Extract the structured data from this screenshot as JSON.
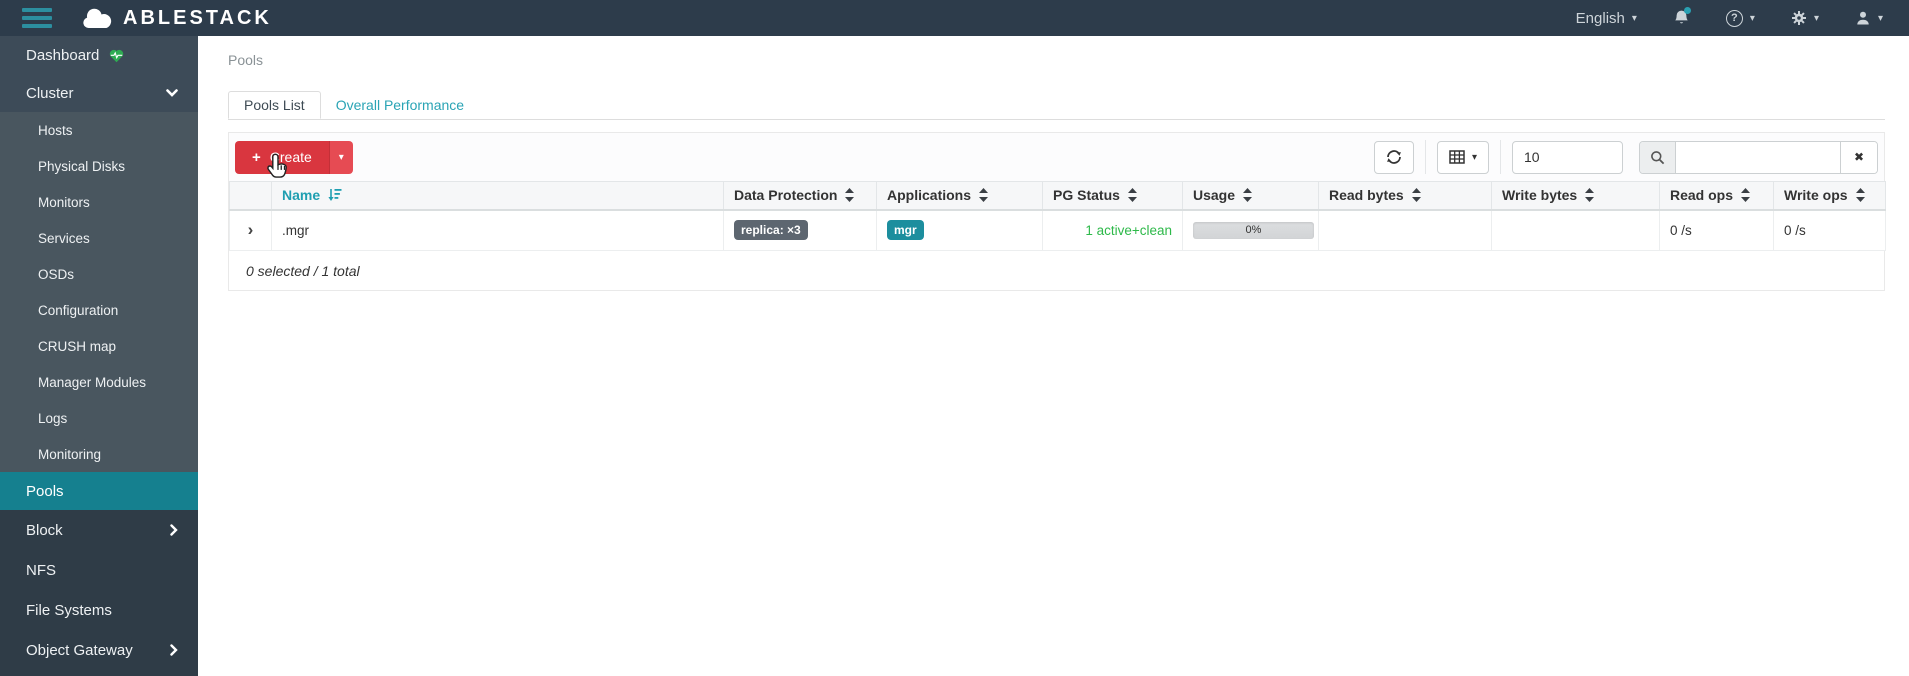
{
  "navbar": {
    "brand": "ABLESTACK",
    "language_menu": "English"
  },
  "sidebar": {
    "dashboard": "Dashboard",
    "cluster": "Cluster",
    "cluster_items": [
      "Hosts",
      "Physical Disks",
      "Monitors",
      "Services",
      "OSDs",
      "Configuration",
      "CRUSH map",
      "Manager Modules",
      "Logs",
      "Monitoring"
    ],
    "pools": "Pools",
    "block": "Block",
    "nfs": "NFS",
    "file_systems": "File Systems",
    "object_gateway": "Object Gateway"
  },
  "breadcrumb": "Pools",
  "tabs": {
    "pools_list": "Pools List",
    "overall_performance": "Overall Performance"
  },
  "toolbar": {
    "create": "Create",
    "page_size": "10"
  },
  "table": {
    "columns": [
      "Name",
      "Data Protection",
      "Applications",
      "PG Status",
      "Usage",
      "Read bytes",
      "Write bytes",
      "Read ops",
      "Write ops"
    ],
    "row": {
      "name": ".mgr",
      "data_protection": "replica: ×3",
      "application": "mgr",
      "pg_status": "1 active+clean",
      "usage_percent": "0%",
      "read_bytes": "",
      "write_bytes": "",
      "read_ops": "0 /s",
      "write_ops": "0 /s"
    }
  },
  "status_footer": "0 selected / 1 total",
  "icons": {
    "plus": "+",
    "caret_down": "▾",
    "clear_x": "✖",
    "row_expand": "›",
    "help": "?"
  },
  "colors": {
    "accent_teal": "#1f9fb1",
    "sidebar_active": "#15808f",
    "create_danger": "#d9363f",
    "pg_status_green": "#2eb94a",
    "badge_dark": "#5d6670",
    "badge_app_teal": "#1c8e9e"
  }
}
